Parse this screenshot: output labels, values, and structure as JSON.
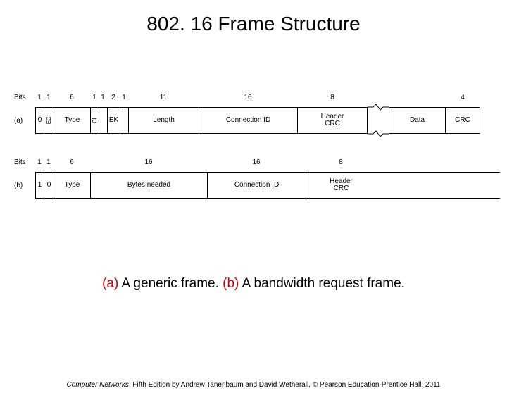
{
  "title": "802. 16 Frame Structure",
  "bits_label": "Bits",
  "rows": {
    "a": {
      "label": "(a)",
      "bits": [
        "1",
        "1",
        "6",
        "1",
        "1",
        "2",
        "1",
        "11",
        "16",
        "8",
        "",
        "",
        "4"
      ],
      "fields": [
        "0",
        "EC",
        "Type",
        "CI",
        "",
        "EK",
        "",
        "Length",
        "Connection ID",
        "Header\nCRC",
        "",
        "Data",
        "CRC"
      ]
    },
    "b": {
      "label": "(b)",
      "bits": [
        "1",
        "1",
        "6",
        "16",
        "16",
        "8"
      ],
      "fields": [
        "1",
        "0",
        "Type",
        "Bytes needed",
        "Connection ID",
        "Header\nCRC"
      ]
    }
  },
  "caption_a": "(a)",
  "caption_a_text": " A generic frame. ",
  "caption_b": "(b)",
  "caption_b_text": " A bandwidth request frame.",
  "footer_book": "Computer Networks",
  "footer_rest": ", Fifth Edition by Andrew Tanenbaum and David Wetherall, © Pearson Education-Prentice Hall, 2011"
}
